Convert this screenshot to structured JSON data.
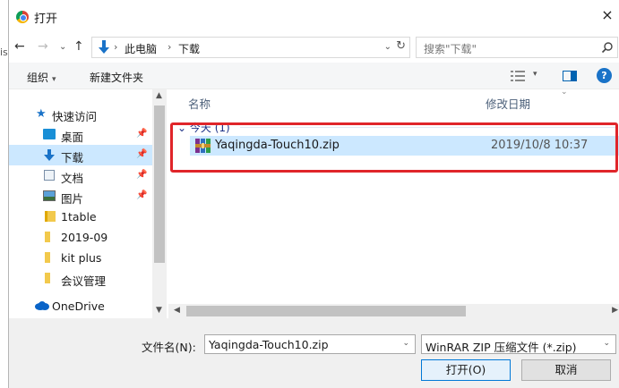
{
  "window": {
    "title": "打开",
    "close_glyph": "×",
    "behind_text": "is"
  },
  "nav": {
    "back": "←",
    "forward": "→",
    "recent": "⌄",
    "up": "↑",
    "address_sep": "›",
    "address_segments": [
      "此电脑",
      "下载"
    ],
    "search_placeholder": "搜索\"下载\""
  },
  "toolbar": {
    "organize_label": "组织",
    "new_folder_label": "新建文件夹"
  },
  "sidebar": {
    "items": [
      {
        "label": "快速访问",
        "icon": "star-icon",
        "pinned": false
      },
      {
        "label": "桌面",
        "icon": "desktop-icon",
        "pinned": true
      },
      {
        "label": "下载",
        "icon": "download-icon",
        "pinned": true,
        "selected": true
      },
      {
        "label": "文档",
        "icon": "document-icon",
        "pinned": true
      },
      {
        "label": "图片",
        "icon": "picture-icon",
        "pinned": true
      },
      {
        "label": "1table",
        "icon": "folder-icon",
        "pinned": false
      },
      {
        "label": "2019-09",
        "icon": "folder-icon",
        "pinned": false
      },
      {
        "label": "kit plus",
        "icon": "folder-icon",
        "pinned": false
      },
      {
        "label": "会议管理",
        "icon": "folder-icon",
        "pinned": false
      },
      {
        "label": "OneDrive",
        "icon": "cloud-icon",
        "pinned": false
      }
    ]
  },
  "filelist": {
    "columns": {
      "name": "名称",
      "modified": "修改日期"
    },
    "group": "今天 (1)",
    "files": [
      {
        "name": "Yaqingda-Touch10.zip",
        "modified": "2019/10/8 10:37",
        "icon": "winrar-zip-icon"
      }
    ]
  },
  "bottom": {
    "filename_label": "文件名(N):",
    "filename_value": "Yaqingda-Touch10.zip",
    "filetype_value": "WinRAR ZIP 压缩文件 (*.zip)",
    "open_button": "打开(O)",
    "cancel_button": "取消"
  },
  "colors": {
    "selection": "#cce8ff",
    "highlight_border": "#e0252a",
    "accent": "#0078d7"
  }
}
